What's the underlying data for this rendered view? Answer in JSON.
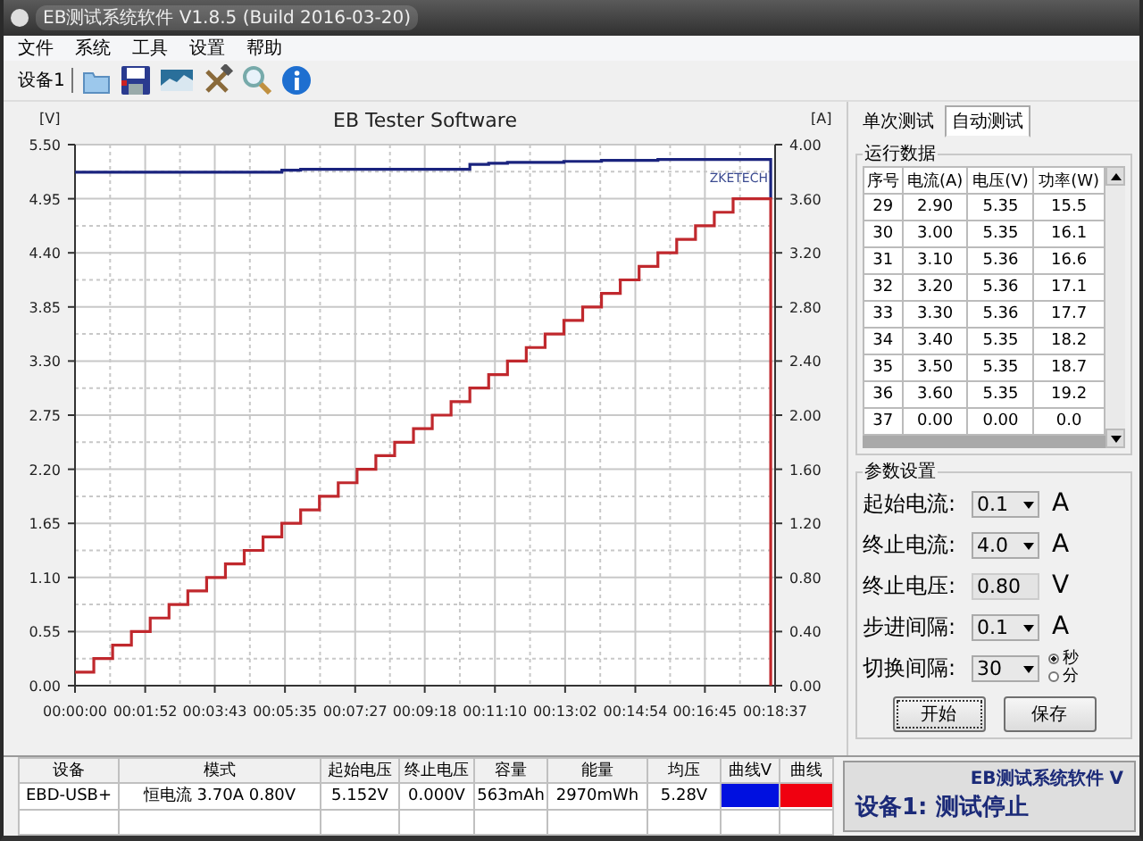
{
  "window": {
    "title": "EB测试系统软件 V1.8.5 (Build 2016-03-20)"
  },
  "menu": [
    "文件",
    "系统",
    "工具",
    "设置",
    "帮助"
  ],
  "toolbar": {
    "device_label": "设备1"
  },
  "chart": {
    "chart_data": {
      "type": "line",
      "grid": true,
      "title": "EB Tester Software",
      "ylabel": "[V]",
      "y2label": "[A]",
      "xlim": [
        0,
        1117
      ],
      "ylim": [
        0,
        5.5
      ],
      "y2lim": [
        0,
        4
      ],
      "x": [
        0,
        30,
        30,
        60,
        60,
        90,
        90,
        120,
        120,
        150,
        150,
        180,
        180,
        210,
        210,
        240,
        240,
        270,
        270,
        300,
        300,
        330,
        330,
        360,
        360,
        390,
        390,
        420,
        420,
        450,
        450,
        480,
        480,
        510,
        510,
        540,
        540,
        570,
        570,
        600,
        600,
        630,
        630,
        660,
        660,
        690,
        690,
        720,
        720,
        750,
        750,
        780,
        780,
        810,
        810,
        840,
        840,
        870,
        870,
        900,
        900,
        930,
        930,
        960,
        960,
        990,
        990,
        1020,
        1020,
        1050,
        1050,
        1080,
        1080,
        1110,
        1110
      ],
      "xticks": [
        {
          "value": 0,
          "label": "00:00:00"
        },
        {
          "value": 112,
          "label": "00:01:52"
        },
        {
          "value": 223,
          "label": "00:03:43"
        },
        {
          "value": 335,
          "label": "00:05:35"
        },
        {
          "value": 447,
          "label": "00:07:27"
        },
        {
          "value": 558,
          "label": "00:09:18"
        },
        {
          "value": 670,
          "label": "00:11:10"
        },
        {
          "value": 782,
          "label": "00:13:02"
        },
        {
          "value": 894,
          "label": "00:14:54"
        },
        {
          "value": 1005,
          "label": "00:16:45"
        },
        {
          "value": 1117,
          "label": "00:18:37"
        }
      ],
      "yticks": [
        {
          "value": 0,
          "label": "0.00"
        },
        {
          "value": 0.55,
          "label": "0.55"
        },
        {
          "value": 1.1,
          "label": "1.10"
        },
        {
          "value": 1.65,
          "label": "1.65"
        },
        {
          "value": 2.2,
          "label": "2.20"
        },
        {
          "value": 2.75,
          "label": "2.75"
        },
        {
          "value": 3.3,
          "label": "3.30"
        },
        {
          "value": 3.85,
          "label": "3.85"
        },
        {
          "value": 4.4,
          "label": "4.40"
        },
        {
          "value": 4.95,
          "label": "4.95"
        },
        {
          "value": 5.5,
          "label": "5.50"
        }
      ],
      "y2ticks": [
        {
          "value": 0,
          "label": "0.00"
        },
        {
          "value": 0.4,
          "label": "0.40"
        },
        {
          "value": 0.8,
          "label": "0.80"
        },
        {
          "value": 1.2,
          "label": "1.20"
        },
        {
          "value": 1.6,
          "label": "1.60"
        },
        {
          "value": 2,
          "label": "2.00"
        },
        {
          "value": 2.4,
          "label": "2.40"
        },
        {
          "value": 2.8,
          "label": "2.80"
        },
        {
          "value": 3.2,
          "label": "3.20"
        },
        {
          "value": 3.6,
          "label": "3.60"
        },
        {
          "value": 4,
          "label": "4.00"
        }
      ],
      "series": [
        {
          "color": "#1a237e",
          "values": [
            5.22,
            5.22,
            5.22,
            5.22,
            5.22,
            5.22,
            5.22,
            5.22,
            5.22,
            5.22,
            5.22,
            5.22,
            5.22,
            5.22,
            5.22,
            5.22,
            5.22,
            5.22,
            5.22,
            5.22,
            5.22,
            5.22,
            5.24,
            5.24,
            5.25,
            5.25,
            5.25,
            5.25,
            5.25,
            5.25,
            5.25,
            5.25,
            5.25,
            5.25,
            5.25,
            5.25,
            5.25,
            5.25,
            5.25,
            5.25,
            5.25,
            5.25,
            5.3,
            5.3,
            5.31,
            5.31,
            5.32,
            5.32,
            5.32,
            5.32,
            5.32,
            5.32,
            5.33,
            5.33,
            5.33,
            5.33,
            5.34,
            5.34,
            5.34,
            5.34,
            5.34,
            5.34,
            5.35,
            5.35,
            5.35,
            5.35,
            5.35,
            5.35,
            5.35,
            5.35,
            5.35,
            5.35,
            5.35,
            5.35,
            4.95
          ]
        },
        {
          "color": "#c0282d",
          "axis": "y2",
          "values": [
            0.1,
            0.1,
            0.2,
            0.2,
            0.3,
            0.3,
            0.4,
            0.4,
            0.5,
            0.5,
            0.6,
            0.6,
            0.7,
            0.7,
            0.8,
            0.8,
            0.9,
            0.9,
            1.0,
            1.0,
            1.1,
            1.1,
            1.2,
            1.2,
            1.3,
            1.3,
            1.4,
            1.4,
            1.5,
            1.5,
            1.6,
            1.6,
            1.7,
            1.7,
            1.8,
            1.8,
            1.9,
            1.9,
            2.0,
            2.0,
            2.1,
            2.1,
            2.2,
            2.2,
            2.3,
            2.3,
            2.4,
            2.4,
            2.5,
            2.5,
            2.6,
            2.6,
            2.7,
            2.7,
            2.8,
            2.8,
            2.9,
            2.9,
            3.0,
            3.0,
            3.1,
            3.1,
            3.2,
            3.2,
            3.3,
            3.3,
            3.4,
            3.4,
            3.5,
            3.5,
            3.6,
            3.6,
            3.6,
            3.6,
            0
          ]
        }
      ],
      "annotations": [
        "ZKETECH"
      ]
    }
  },
  "tabs": [
    {
      "label": "单次测试",
      "selected": false
    },
    {
      "label": "自动测试",
      "selected": true
    }
  ],
  "run_data": {
    "title": "运行数据",
    "columns": [
      "序号",
      "电流(A)",
      "电压(V)",
      "功率(W)"
    ],
    "rows": [
      [
        "29",
        "2.90",
        "5.35",
        "15.5"
      ],
      [
        "30",
        "3.00",
        "5.35",
        "16.1"
      ],
      [
        "31",
        "3.10",
        "5.36",
        "16.6"
      ],
      [
        "32",
        "3.20",
        "5.36",
        "17.1"
      ],
      [
        "33",
        "3.30",
        "5.36",
        "17.7"
      ],
      [
        "34",
        "3.40",
        "5.35",
        "18.2"
      ],
      [
        "35",
        "3.50",
        "5.35",
        "18.7"
      ],
      [
        "36",
        "3.60",
        "5.35",
        "19.2"
      ],
      [
        "37",
        "0.00",
        "0.00",
        "0.0"
      ]
    ]
  },
  "params": {
    "title": "参数设置",
    "fields": [
      {
        "label": "起始电流:",
        "kind": "dropdown",
        "value": "0.1",
        "unit": "A"
      },
      {
        "label": "终止电流:",
        "kind": "dropdown",
        "value": "4.0",
        "unit": "A"
      },
      {
        "label": "终止电压:",
        "kind": "text",
        "value": "0.80",
        "unit": "V"
      },
      {
        "label": "步进间隔:",
        "kind": "dropdown",
        "value": "0.1",
        "unit": "A"
      },
      {
        "label": "切换间隔:",
        "kind": "dropdown",
        "value": "30",
        "radios": [
          {
            "label": "秒",
            "selected": true
          },
          {
            "label": "分",
            "selected": false
          }
        ]
      }
    ],
    "buttons": [
      "开始",
      "保存"
    ]
  },
  "results": {
    "columns": [
      "设备",
      "模式",
      "起始电压",
      "终止电压",
      "容量",
      "能量",
      "均压",
      "曲线V",
      "曲线"
    ],
    "rows": [
      {
        "cells": [
          "EBD-USB+",
          "恒电流  3.70A  0.80V",
          "5.152V",
          "0.000V",
          "563mAh",
          "2970mWh",
          "5.28V"
        ],
        "curves": [
          {
            "color": "#0010e0"
          },
          {
            "color": "#f00010"
          }
        ]
      }
    ]
  },
  "status": {
    "app": "EB测试系统软件 V",
    "message": "设备1: 测试停止"
  }
}
